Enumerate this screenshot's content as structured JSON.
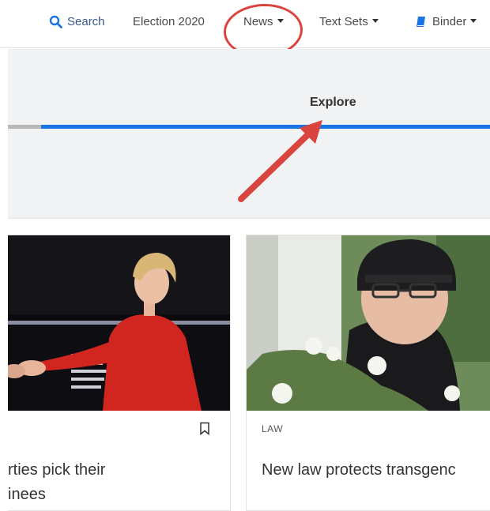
{
  "nav": {
    "items": [
      {
        "label": "Search",
        "icon": "search-icon"
      },
      {
        "label": "Election 2020"
      },
      {
        "label": "News",
        "dropdown": true
      },
      {
        "label": "Text Sets",
        "dropdown": true
      },
      {
        "label": "Binder",
        "icon": "binder-icon",
        "dropdown": true
      }
    ],
    "accent_color": "#1b74e4"
  },
  "tabs": {
    "active_label": "Explore"
  },
  "annotation": {
    "color": "#d9443e",
    "circled_item": "News"
  },
  "cards": [
    {
      "tag": "",
      "headline_lines": [
        "rties pick their",
        "inees"
      ],
      "image": "debate-stage-photo"
    },
    {
      "tag": "LAW",
      "headline_lines": [
        "New law protects transgenc"
      ],
      "image": "student-portrait-photo"
    }
  ]
}
